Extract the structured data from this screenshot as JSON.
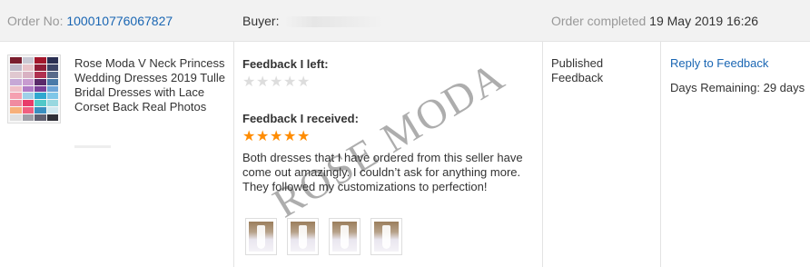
{
  "header": {
    "order_label": "Order No:",
    "order_number": "100010776067827",
    "buyer_label": "Buyer:",
    "completed_label": "Order completed",
    "completed_date": "19 May 2019 16:26"
  },
  "product": {
    "title": "Rose Moda V Neck Princess Wedding Dresses 2019 Tulle Bridal Dresses with Lace Corset Back Real Photos",
    "swatch_colors": [
      "#7a1d2e",
      "#c9c9d4",
      "#a3172c",
      "#2a2f52",
      "#c0b8c8",
      "#e7c3c9",
      "#8f1d37",
      "#3c4466",
      "#e0c8d0",
      "#d9b2c3",
      "#b03050",
      "#586a8a",
      "#c6a8d6",
      "#c89bd0",
      "#5a2a6a",
      "#4a7aa8",
      "#f0c0c8",
      "#b07bc7",
      "#7a3f98",
      "#6fa6d8",
      "#f5a0b0",
      "#9fd0e8",
      "#2fa8d0",
      "#7fc7e8",
      "#f08aa0",
      "#e83c6a",
      "#50c8c8",
      "#98d8e0",
      "#f7b07a",
      "#f06080",
      "#3a8fc0",
      "#d0e8f0",
      "#e0e0e0",
      "#a0a0a8",
      "#606070",
      "#303038"
    ]
  },
  "feedback": {
    "left_heading": "Feedback I left:",
    "left_stars": 0,
    "received_heading": "Feedback I received:",
    "received_stars": 5,
    "received_text": "Both dresses that I have ordered from this seller have come out amazingly. I couldn’t ask for anything more. They followed my customizations to perfection!",
    "photo_count": 4
  },
  "status": {
    "text": "Published Feedback"
  },
  "action": {
    "reply_label": "Reply to Feedback",
    "days_remaining": "Days Remaining: 29 days"
  },
  "watermark": {
    "text": "ROSE MODA"
  },
  "colors": {
    "link": "#1a66b3",
    "star_on": "#ff8c00",
    "star_off": "#dddddd",
    "header_bg": "#f2f2f2"
  }
}
